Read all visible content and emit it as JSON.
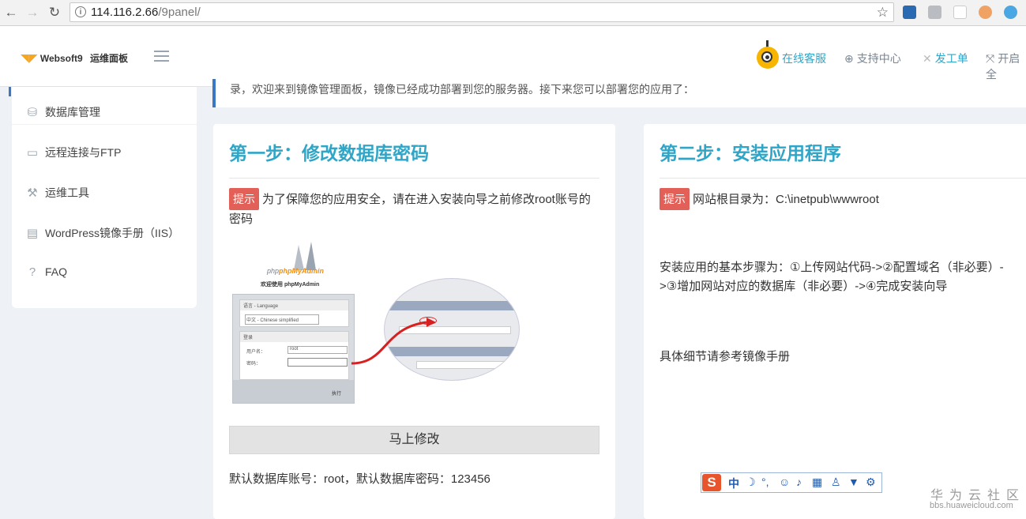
{
  "browser": {
    "url_host": "114.116.2.66",
    "url_path": "/9panel/"
  },
  "header": {
    "logo_text": "Websoft9",
    "logo_sub": "运维面板",
    "nav": [
      {
        "label": "在线客服"
      },
      {
        "label": "支持中心"
      },
      {
        "label": "发工单"
      },
      {
        "label": "开启全"
      }
    ]
  },
  "sidebar": {
    "items": [
      {
        "label": "数据库管理"
      },
      {
        "label": "远程连接与FTP"
      },
      {
        "label": "运维工具"
      },
      {
        "label": "WordPress镜像手册（IIS）"
      },
      {
        "label": "FAQ"
      }
    ]
  },
  "banner": {
    "text": "录，欢迎来到镜像管理面板，镜像已经成功部署到您的服务器。接下来您可以部署您的应用了："
  },
  "card1": {
    "title": "第一步：修改数据库密码",
    "tag": "提示",
    "tip": "为了保障您的应用安全，请在进入安装向导之前修改root账号的密码",
    "button": "马上修改",
    "footer": "默认数据库账号：root，默认数据库密码：123456",
    "shot": {
      "brand": "phpMyAdmin",
      "welcome": "欢迎使用 phpMyAdmin",
      "language": "语言 - Language",
      "lang_value": "中文 - Chinese simplified",
      "login": "登录",
      "user_label": "用户名：",
      "user_value": "root",
      "pass_label": "密码：",
      "go": "执行"
    }
  },
  "card2": {
    "title": "第二步：安装应用程序",
    "tag": "提示",
    "tip": "网站根目录为：C:\\inetpub\\wwwroot",
    "steps": "安装应用的基本步骤为：①上传网站代码->②配置域名（非必要）->③增加网站对应的数据库（非必要）->④完成安装向导",
    "manual": "具体细节请参考镜像手册"
  },
  "ime": {
    "mode": "中"
  },
  "watermark": {
    "title": "华为云社区",
    "url": "bbs.huaweicloud.com"
  },
  "colors": {
    "accent": "#2fa6c7",
    "tag": "#e26058",
    "sidebar_edge": "#3a78c3"
  }
}
